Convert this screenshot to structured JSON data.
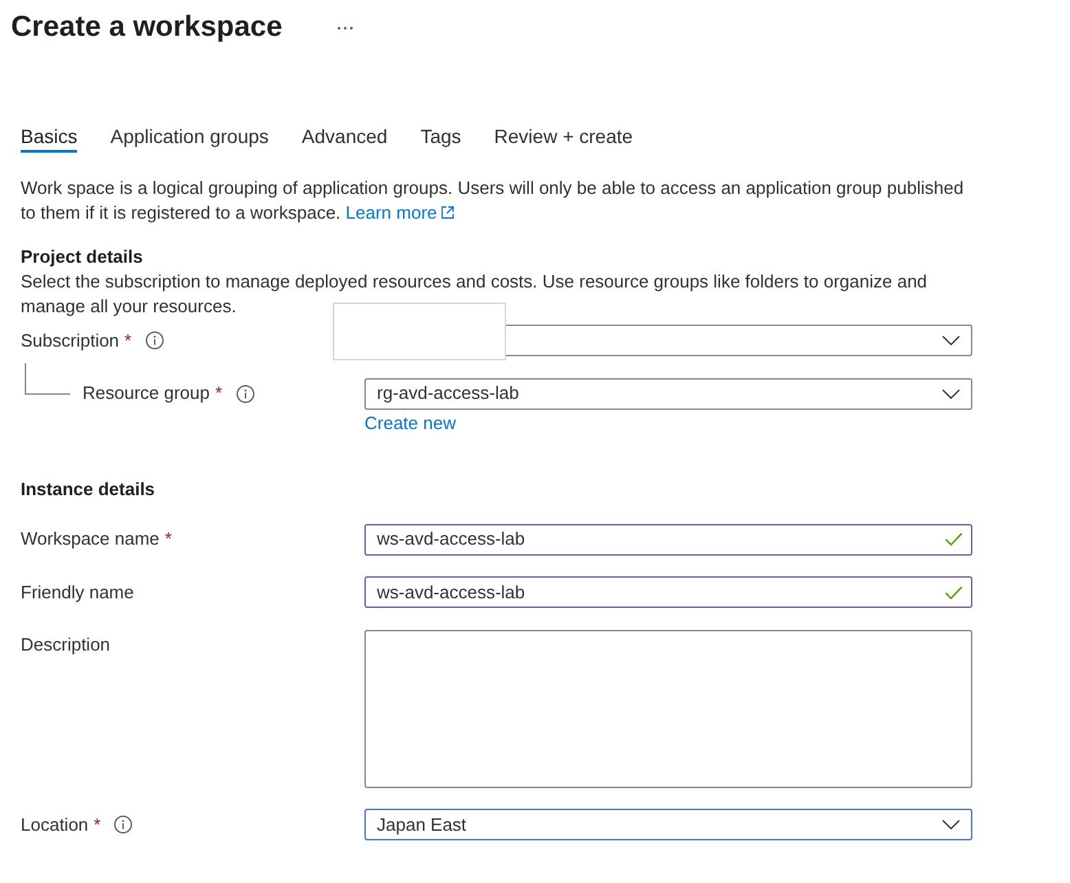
{
  "header": {
    "title": "Create a workspace"
  },
  "tabs": [
    {
      "label": "Basics",
      "selected": true
    },
    {
      "label": "Application groups",
      "selected": false
    },
    {
      "label": "Advanced",
      "selected": false
    },
    {
      "label": "Tags",
      "selected": false
    },
    {
      "label": "Review + create",
      "selected": false
    }
  ],
  "intro": {
    "text": "Work space is a logical grouping of application groups. Users will only be able to access an application group published to them if it is registered to a workspace.",
    "link": "Learn more"
  },
  "sections": [
    {
      "heading": "Project details",
      "description": "Select the subscription to manage deployed resources and costs. Use resource groups like folders to organize and manage all your resources.",
      "fields": [
        {
          "kind": "dropdown",
          "label": "Subscription",
          "required_mark": "*",
          "info": true,
          "redacted": true,
          "focused": false,
          "children": [
            {
              "kind": "dropdown",
              "label": "Resource group",
              "required_mark": "*",
              "info": true,
              "value": "rg-avd-access-lab",
              "focused": false,
              "link": "Create new"
            }
          ]
        }
      ]
    },
    {
      "heading": "Instance details",
      "fields": [
        {
          "kind": "text",
          "label": "Workspace name",
          "required_mark": "*",
          "value": "ws-avd-access-lab",
          "valid": true
        },
        {
          "kind": "text",
          "label": "Friendly name",
          "value": "ws-avd-access-lab",
          "valid": true
        },
        {
          "kind": "textarea",
          "label": "Description"
        },
        {
          "kind": "dropdown",
          "label": "Location",
          "required_mark": "*",
          "info": true,
          "value": "Japan East",
          "focused": true
        }
      ]
    }
  ]
}
